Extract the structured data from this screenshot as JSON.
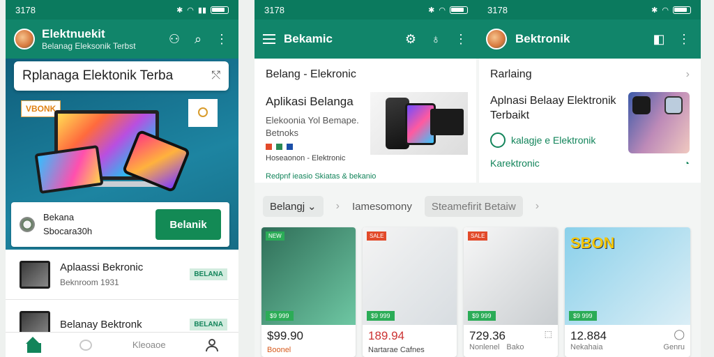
{
  "phone1": {
    "status_time": "3178",
    "app_title": "Elektnuekit",
    "app_subtitle": "Belanag Eleksonik Terbst",
    "search_value": "Rplanaga Elektonik Terba",
    "hero_tag_left": "VBONK",
    "card": {
      "title": "Bekana",
      "subtitle": "Sbocara30h",
      "button": "Belanik"
    },
    "list": [
      {
        "title": "Aplaassi Bekronic",
        "subtitle": "Beknroom 1931",
        "badge": "BELANA"
      },
      {
        "title": "Belanay Bektronk",
        "subtitle": "",
        "badge": "BELANA"
      }
    ],
    "bottom_nav": {
      "middle_label": "Kleoaoe"
    }
  },
  "phone2": {
    "status_time": "3178",
    "status_time_2": "3178",
    "appbar_left_title": "Bekamic",
    "appbar_right_title": "Bektronik",
    "panel_a": {
      "header": "Belang - Elekronic",
      "title": "Aplikasi Belanga",
      "description": "Elekoonia Yol Bemape. Betnoks",
      "meta": "Hoseaonon - Elektronic",
      "link": "Redpnf ieasio Skiatas & bekanio"
    },
    "panel_b": {
      "header": "Rarlaing",
      "title": "Aplnasi Belaay Elektronik Terbaikt",
      "feature": "kalagje e Elektronik",
      "link": "Karektronic"
    },
    "filters": {
      "chip": "Belangj",
      "option_1": "Iamesomony",
      "option_2": "Steamefirit Betaiw"
    },
    "products": [
      {
        "price": "$99.90",
        "name": "Boonel",
        "tag": "",
        "price_tag": "$9 999"
      },
      {
        "price": "189.94",
        "name": "Nartarae Cafnes",
        "tag": "",
        "price_tag": "$9 999"
      },
      {
        "price": "729.36",
        "name": "Nonlenel",
        "meta": "Bako",
        "tag": "",
        "price_tag": "$9 999"
      },
      {
        "price": "12.884",
        "name": "Nekahaia",
        "meta": "Genru",
        "tag": "SBON",
        "price_tag": "$9 999"
      }
    ]
  },
  "colors": {
    "primary": "#11856a",
    "status": "#0b7a5e",
    "accent_green": "#138a55",
    "sale_red": "#e24a2a"
  }
}
